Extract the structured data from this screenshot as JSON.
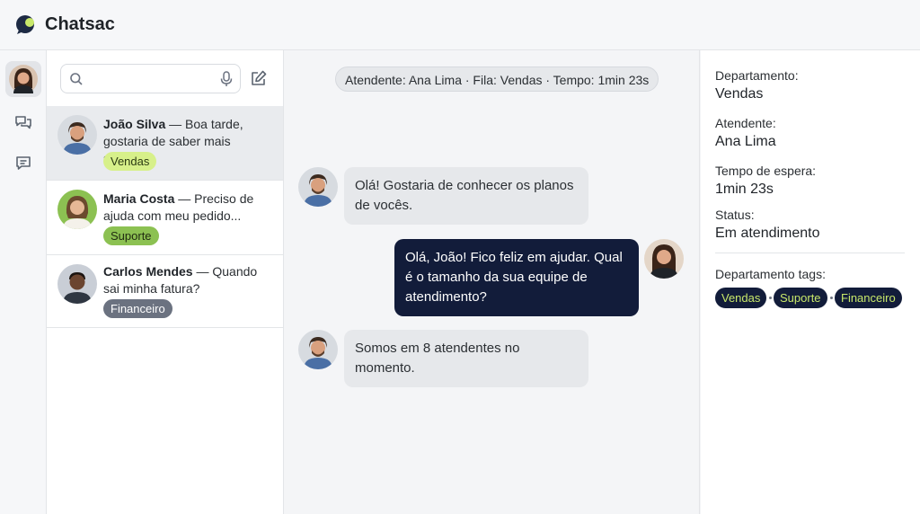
{
  "app": {
    "title": "Chatsac"
  },
  "search": {
    "placeholder": ""
  },
  "conversations": [
    {
      "name": "João Silva",
      "preview": " — Boa tarde, gostaria de saber mais sobre...",
      "tag": "Vendas"
    },
    {
      "name": "Maria Costa",
      "preview": " — Preciso de ajuda com meu pedido...",
      "tag": "Suporte"
    },
    {
      "name": "Carlos Mendes",
      "preview": " — Quando sai minha fatura?",
      "tag": "Financeiro"
    }
  ],
  "chat": {
    "meta": "Atendente: Ana Lima · Fila: Vendas · Tempo: 1min 23s",
    "messages": [
      {
        "direction": "in",
        "text": "Olá! Gostaria de conhecer os planos de vocês."
      },
      {
        "direction": "out",
        "text": "Olá, João! Fico feliz em ajudar. Qual é o tamanho da sua equipe de atendimento?"
      },
      {
        "direction": "in",
        "text": "Somos em 8 atendentes no momento."
      }
    ]
  },
  "details": {
    "department_label": "Departamento:",
    "department_value": "Vendas",
    "agent_label": "Atendente:",
    "agent_value": "Ana Lima",
    "wait_label": "Tempo de espera:",
    "wait_value": "1min 23s",
    "status_label": "Status:",
    "status_value": "Em atendimento",
    "tags_label": "Departamento tags:",
    "tags": [
      "Vendas",
      "Suporte",
      "Financeiro"
    ]
  },
  "colors": {
    "accent_green": "#c8e86a",
    "tag_vendas_bg": "#d7f08a",
    "tag_suporte_bg": "#8cc152",
    "tag_financeiro_bg": "#6b7280",
    "agent_bubble": "#121c3a"
  },
  "icons": [
    "search-icon",
    "mic-icon",
    "compose-icon",
    "conversations-icon",
    "messages-icon"
  ]
}
